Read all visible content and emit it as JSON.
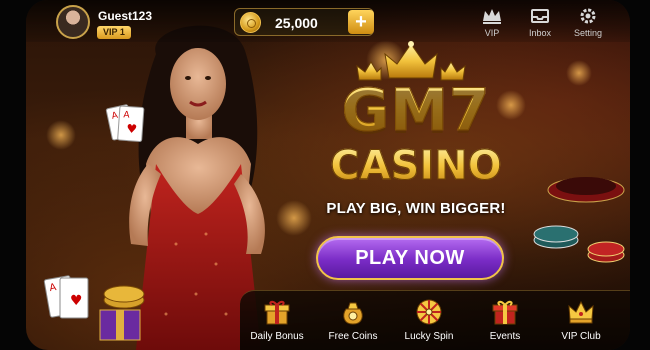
{
  "user": {
    "name": "Guest123",
    "vip_level": "VIP 1"
  },
  "wallet": {
    "balance": "25,000",
    "add_label": "+"
  },
  "top_nav": [
    {
      "label": "VIP",
      "icon": "crown-icon"
    },
    {
      "label": "Inbox",
      "icon": "inbox-icon"
    },
    {
      "label": "Setting",
      "icon": "gear-icon"
    }
  ],
  "hero": {
    "logo_line1": "GM7",
    "logo_line2": "CASINO",
    "tagline": "PLAY BIG, WIN BIGGER!",
    "play_button": "PLAY NOW"
  },
  "bottom_nav": [
    {
      "label": "Daily Bonus",
      "icon": "gift-box-icon"
    },
    {
      "label": "Free Coins",
      "icon": "coin-bag-icon"
    },
    {
      "label": "Lucky Spin",
      "icon": "wheel-icon"
    },
    {
      "label": "Events",
      "icon": "event-gift-icon"
    },
    {
      "label": "VIP Club",
      "icon": "vip-crown-icon"
    }
  ],
  "colors": {
    "gold": "#f5c842",
    "purple_button": "#7a2cc6",
    "background": "#2a1408"
  }
}
